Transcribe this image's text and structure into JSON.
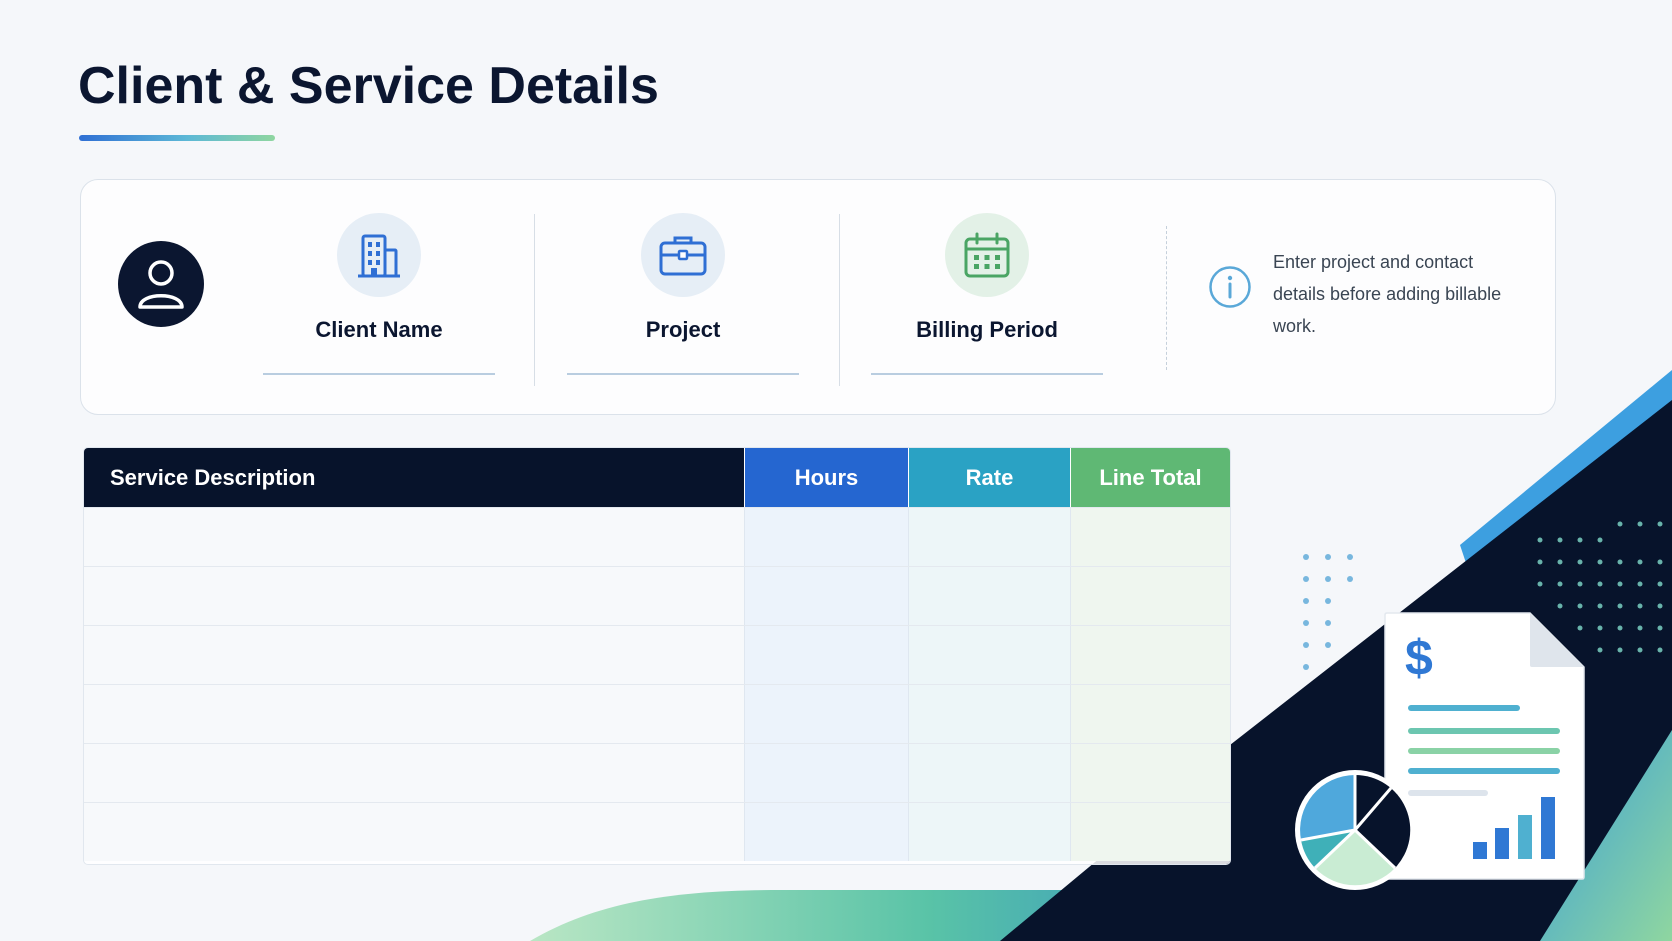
{
  "page": {
    "title": "Client & Service Details"
  },
  "client_card": {
    "fields": [
      {
        "label": "Client Name",
        "icon": "building-icon"
      },
      {
        "label": "Project",
        "icon": "briefcase-icon"
      },
      {
        "label": "Billing Period",
        "icon": "calendar-icon"
      }
    ],
    "info_text": "Enter project and contact details before adding billable work."
  },
  "services_table": {
    "columns": [
      "Service Description",
      "Hours",
      "Rate",
      "Line Total"
    ],
    "rows": [
      [
        "",
        "",
        "",
        ""
      ],
      [
        "",
        "",
        "",
        ""
      ],
      [
        "",
        "",
        "",
        ""
      ],
      [
        "",
        "",
        "",
        ""
      ],
      [
        "",
        "",
        "",
        ""
      ],
      [
        "",
        "",
        "",
        ""
      ]
    ]
  },
  "colors": {
    "navy": "#0b1630",
    "hours_header": "#2566d0",
    "rate_header": "#2aa2c4",
    "total_header": "#5fb874"
  },
  "illustration": {
    "currency_symbol": "$"
  }
}
